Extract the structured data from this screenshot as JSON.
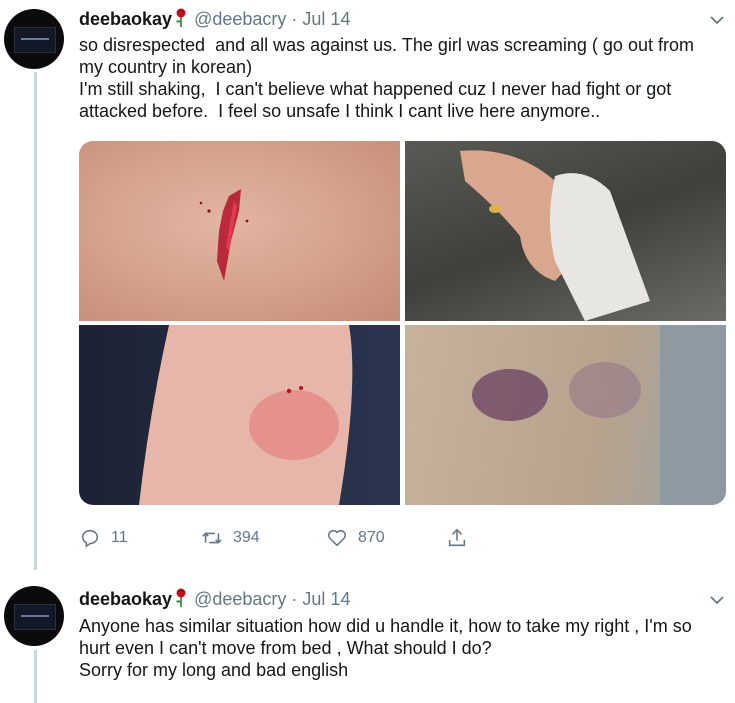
{
  "tweets": [
    {
      "name": "deebaokay",
      "handle": "@deebacry",
      "dot": "·",
      "date": "Jul 14",
      "paragraphs": [
        "so disrespected  and all was against us. The girl was screaming ( go out from my country in korean)",
        "I'm still shaking,  I can't believe what happened cuz I never had fight or got attacked before.  I feel so unsafe I think I cant live here anymore.."
      ],
      "media_icons": [
        "wound-photo-icon",
        "bandaged-hand-photo-icon",
        "wrist-injury-photo-icon",
        "bruise-photo-icon"
      ],
      "actions": {
        "replies": "11",
        "retweets": "394",
        "likes": "870"
      }
    },
    {
      "name": "deebaokay",
      "handle": "@deebacry",
      "dot": "·",
      "date": "Jul 14",
      "paragraphs": [
        "Anyone has similar situation how did u handle it, how to take my right , I'm so hurt even I can't move from bed , What should I do?",
        "Sorry for my long and bad english"
      ]
    }
  ],
  "colors": {
    "text": "#14171a",
    "secondary": "#657786",
    "thread_line": "#ccd6dd",
    "rose": "#c0111f"
  }
}
